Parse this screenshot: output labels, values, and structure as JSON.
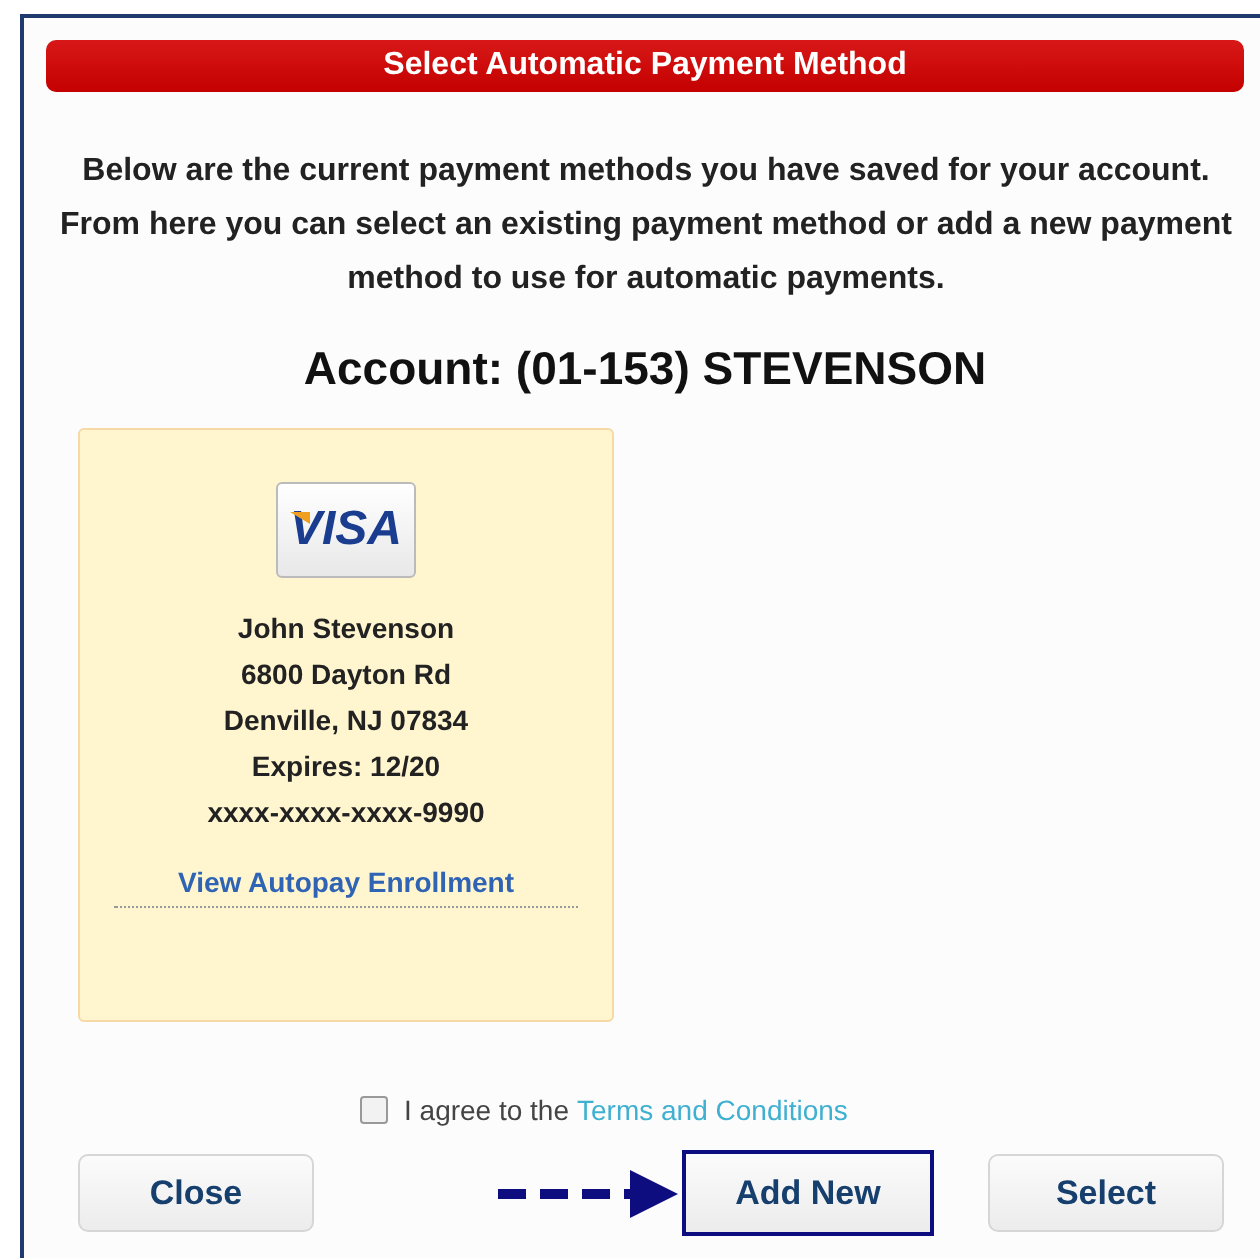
{
  "header": {
    "title": "Select Automatic Payment Method"
  },
  "intro": "Below are the current payment methods you have saved for your account. From here you can select an existing payment method or add a new payment method to use for automatic payments.",
  "account": "Account: (01-153) STEVENSON",
  "cards": [
    {
      "brand": "VISA",
      "lines": [
        "John Stevenson",
        "6800 Dayton Rd",
        "Denville, NJ 07834",
        "Expires: 12/20",
        "xxxx-xxxx-xxxx-9990"
      ],
      "link": "View Autopay Enrollment"
    }
  ],
  "agreement": {
    "checked": false,
    "text": "I agree to the",
    "link": "Terms and Conditions"
  },
  "buttons": [
    {
      "label": "Close",
      "highlighted": false
    },
    {
      "label": "Add New",
      "highlighted": true
    },
    {
      "label": "Select",
      "highlighted": false
    }
  ]
}
